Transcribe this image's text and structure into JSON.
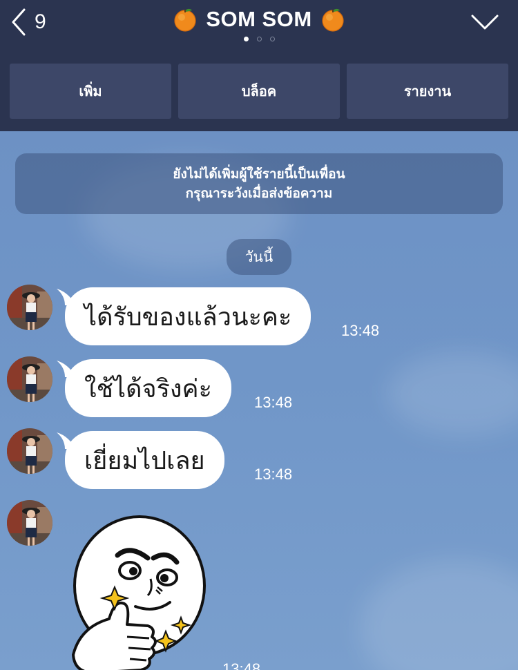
{
  "header": {
    "back_count": "9",
    "title": "SOM SOM",
    "title_icon": "tangerine-emoji",
    "page_dots": [
      true,
      false,
      false
    ],
    "collapse_icon": "chevron-down-icon"
  },
  "actions": {
    "add_label": "เพิ่ม",
    "block_label": "บล็อค",
    "report_label": "รายงาน"
  },
  "chat": {
    "notice_line1": "ยังไม่ได้เพิ่มผู้ใช้รายนี้เป็นเพื่อน",
    "notice_line2": "กรุณาระวังเมื่อส่งข้อความ",
    "date_label": "วันนี้",
    "messages": [
      {
        "text": "ได้รับของแล้วนะคะ",
        "time": "13:48"
      },
      {
        "text": "ใช้ได้จริงค่ะ",
        "time": "13:48"
      },
      {
        "text": "เยี่ยมไปเลย",
        "time": "13:48"
      }
    ],
    "sticker": {
      "name": "thumbs-up-moon-sticker",
      "time": "13:48"
    }
  },
  "colors": {
    "header_bg": "#2b3450",
    "action_button_bg": "#3d4768",
    "chat_bg": "#7096c8",
    "bubble_bg": "#ffffff"
  }
}
